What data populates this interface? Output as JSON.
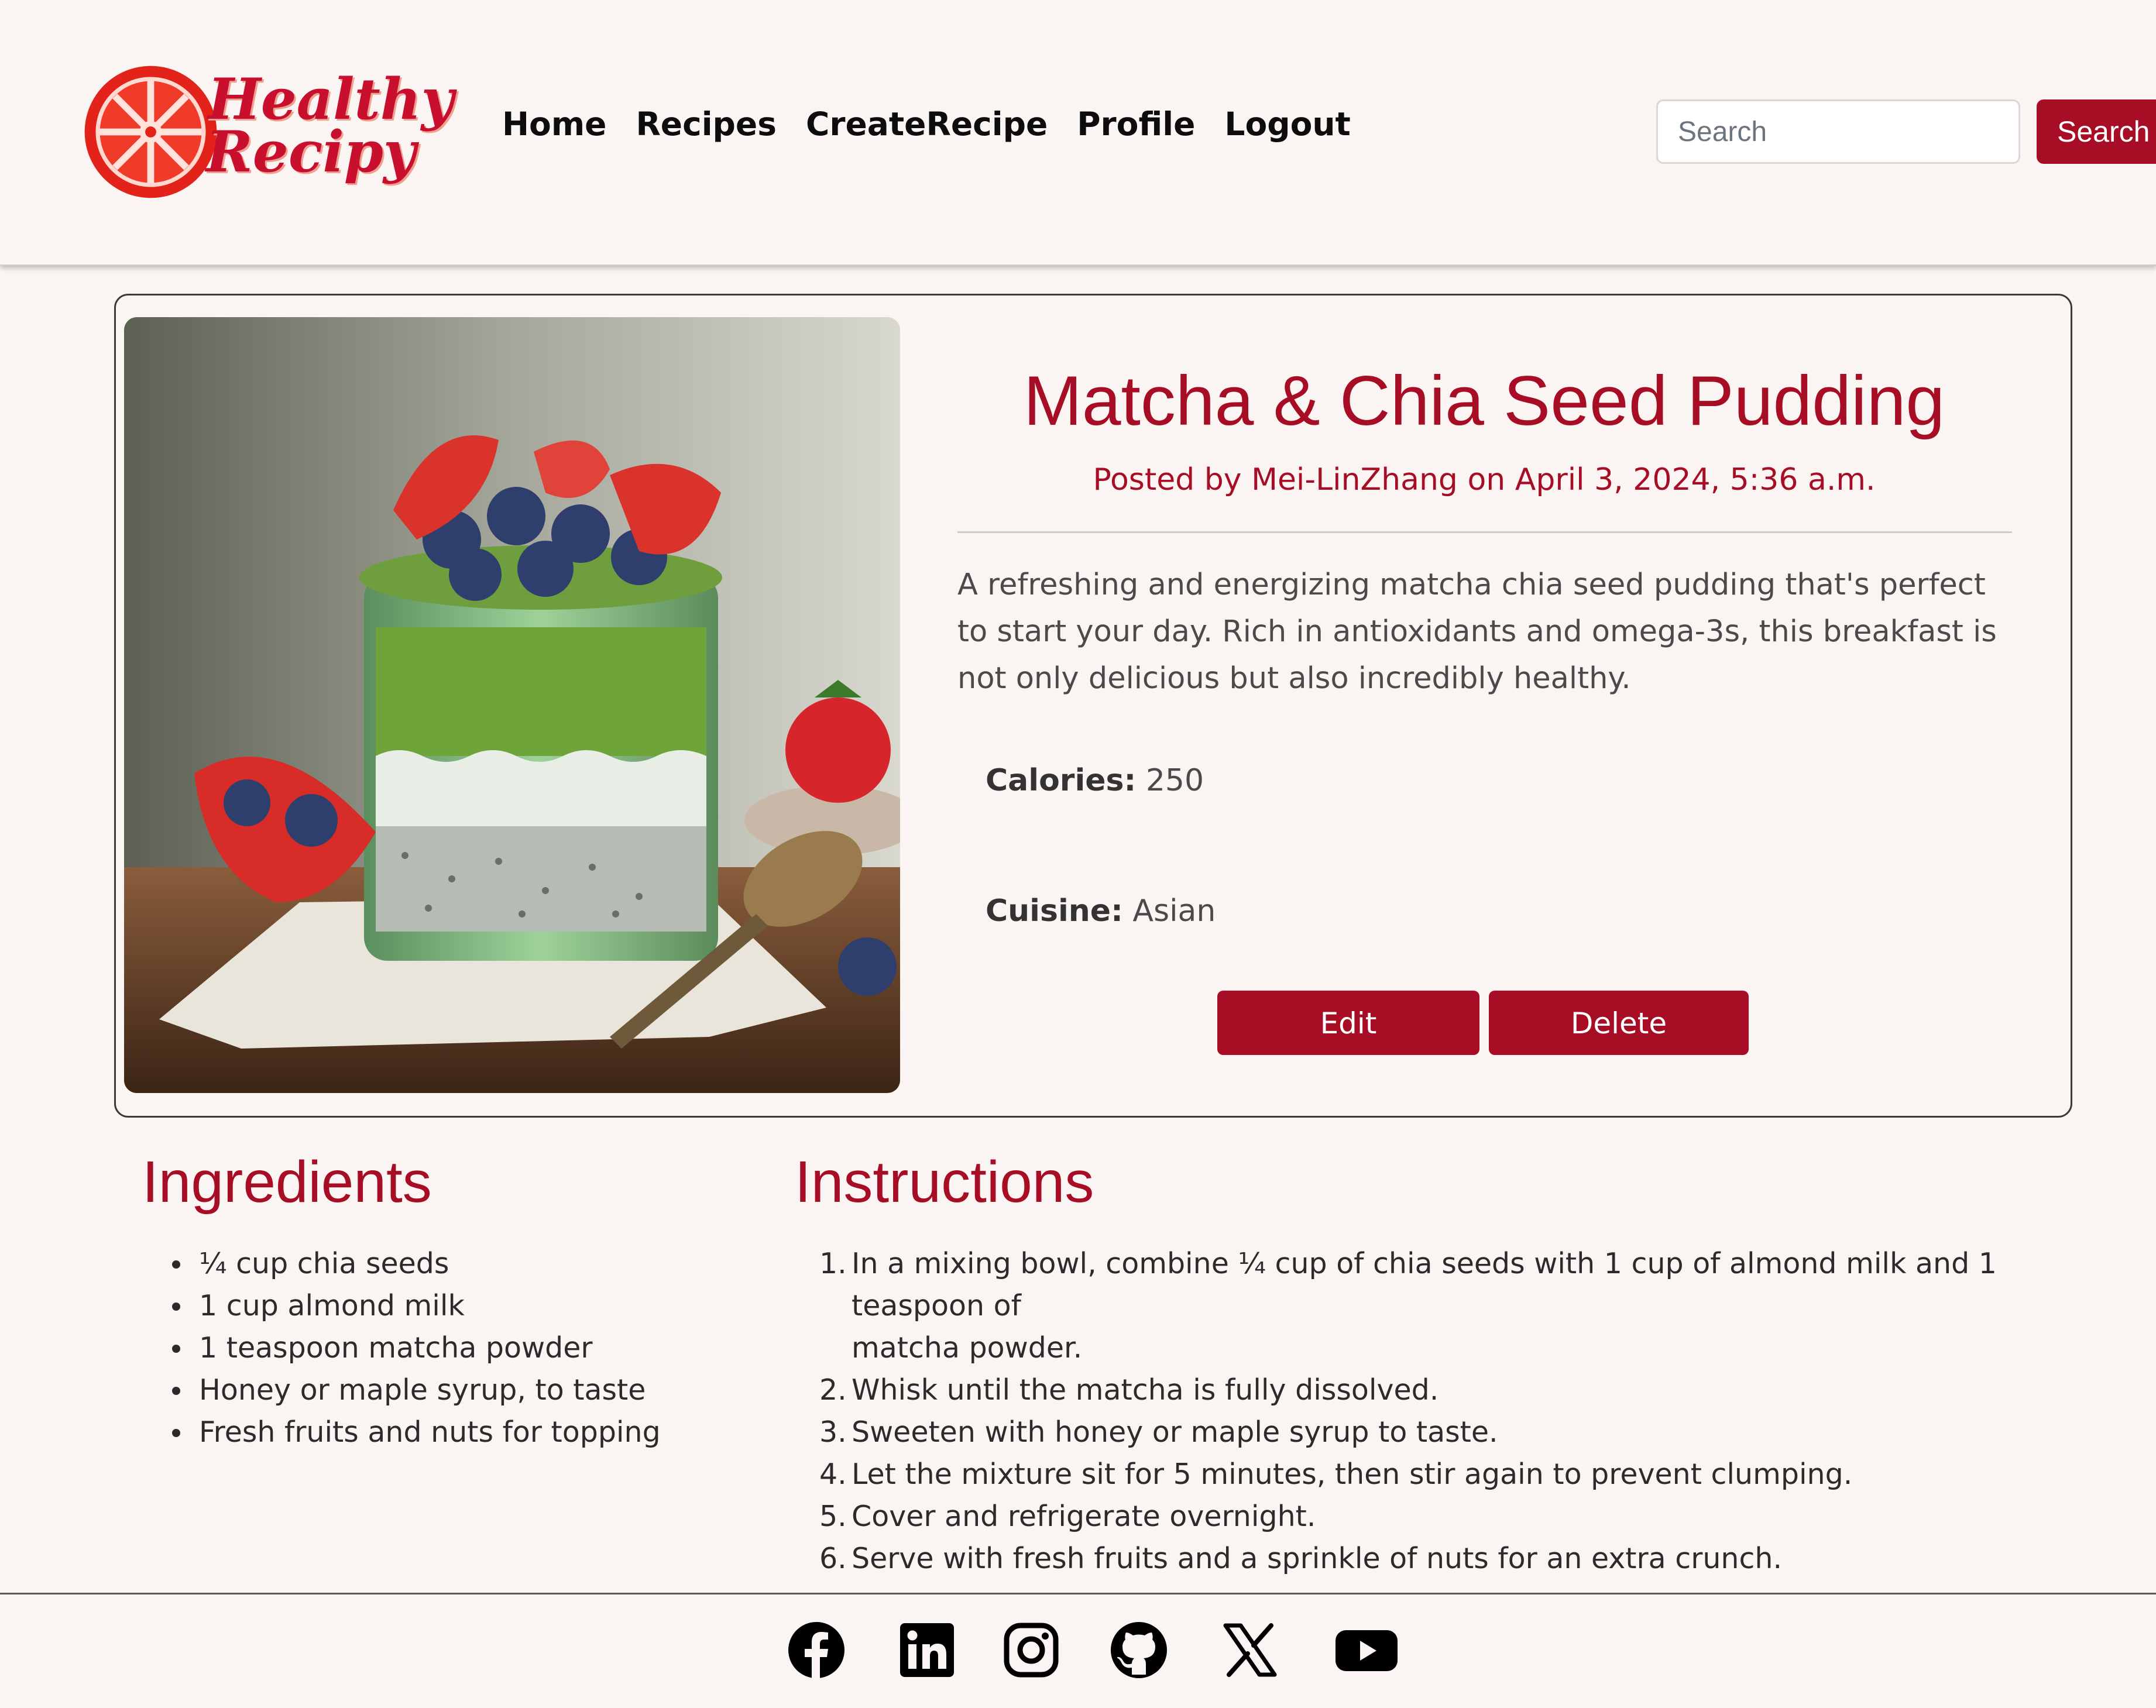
{
  "brand": {
    "line1": "Healthy",
    "line2": "Recipy",
    "logo_icon": "citrus-slice-icon"
  },
  "nav": {
    "items": [
      {
        "label": "Home"
      },
      {
        "label": "Recipes"
      },
      {
        "label": "CreateRecipe"
      },
      {
        "label": "Profile"
      },
      {
        "label": "Logout"
      }
    ]
  },
  "search": {
    "placeholder": "Search",
    "value": "",
    "button_label": "Search"
  },
  "recipe": {
    "title": "Matcha & Chia Seed Pudding",
    "posted_by": "Posted by Mei-LinZhang on April 3, 2024, 5:36 a.m.",
    "description": "A refreshing and energizing matcha chia seed pudding that's perfect to start your day. Rich in antioxidants and omega-3s, this breakfast is not only delicious but also incredibly healthy.",
    "calories_label": "Calories:",
    "calories_value": "250",
    "cuisine_label": "Cuisine:",
    "cuisine_value": "Asian",
    "edit_label": "Edit",
    "delete_label": "Delete"
  },
  "ingredients": {
    "heading": "Ingredients",
    "items": [
      "¼ cup chia seeds",
      "1 cup almond milk",
      "1 teaspoon matcha powder",
      "Honey or maple syrup, to taste",
      "Fresh fruits and nuts for topping"
    ]
  },
  "instructions": {
    "heading": "Instructions",
    "steps": [
      {
        "num": "1.",
        "text": "In a mixing bowl, combine ¼ cup of chia seeds with 1 cup of almond milk and 1 teaspoon of",
        "text2": "matcha powder."
      },
      {
        "num": "2.",
        "text": "Whisk until the matcha is fully dissolved."
      },
      {
        "num": "3.",
        "text": "Sweeten with honey or maple syrup to taste."
      },
      {
        "num": "4.",
        "text": "Let the mixture sit for 5 minutes, then stir again to prevent clumping."
      },
      {
        "num": "5.",
        "text": "Cover and refrigerate overnight."
      },
      {
        "num": "6.",
        "text": "Serve with fresh fruits and a sprinkle of nuts for an extra crunch."
      }
    ]
  },
  "footer": {
    "icons": [
      "facebook-icon",
      "linkedin-icon",
      "instagram-icon",
      "github-icon",
      "x-icon",
      "youtube-icon"
    ]
  },
  "colors": {
    "accent": "#a70d24",
    "background": "#faf5f3"
  }
}
